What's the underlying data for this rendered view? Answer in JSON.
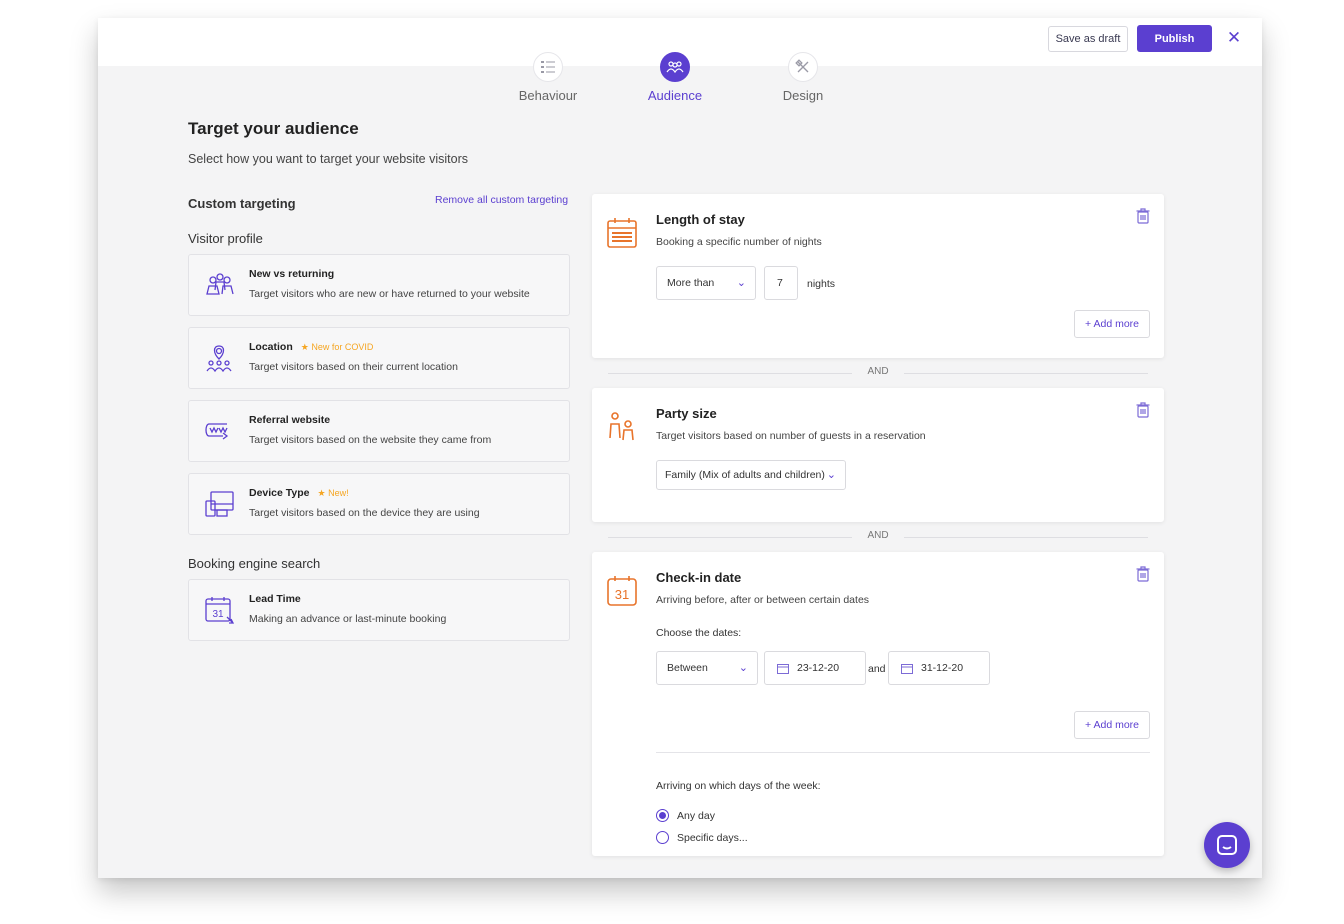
{
  "topbar": {
    "draft_label": "Save as draft",
    "publish_label": "Publish",
    "close_label": "✕"
  },
  "steps": [
    {
      "label": "Behaviour",
      "icon": "list-icon",
      "active": false
    },
    {
      "label": "Audience",
      "icon": "audience-icon",
      "active": true
    },
    {
      "label": "Design",
      "icon": "design-tools-icon",
      "active": false
    }
  ],
  "header": {
    "title": "Target your audience",
    "subtitle": "Select how you want to target your website visitors"
  },
  "custom": {
    "title": "Custom targeting",
    "remove_label": "Remove all custom targeting"
  },
  "visitor_profile": {
    "title": "Visitor profile",
    "options": [
      {
        "title": "New vs returning",
        "badge": "",
        "desc": "Target visitors who are new or have returned to your website",
        "icon": "people-icon"
      },
      {
        "title": "Location",
        "badge": "★ New for COVID",
        "desc": "Target visitors based on their current location",
        "icon": "location-icon"
      },
      {
        "title": "Referral website",
        "badge": "",
        "desc": "Target visitors based on the website they came from",
        "icon": "www-icon"
      },
      {
        "title": "Device Type",
        "badge": "★ New!",
        "desc": "Target visitors based on the device they are using",
        "icon": "devices-icon"
      }
    ]
  },
  "booking_search": {
    "title": "Booking engine search",
    "options": [
      {
        "title": "Lead Time",
        "desc": "Making an advance or last-minute booking",
        "icon": "calendar-31-icon"
      }
    ]
  },
  "stay_card": {
    "title": "Length of stay",
    "desc": "Booking a specific number of nights",
    "condition": "More than",
    "nights_value": "7",
    "nights_label": "nights",
    "add_more": "+ Add more"
  },
  "and_label": "AND",
  "party_card": {
    "title": "Party size",
    "desc": "Target visitors based on number of guests in a reservation",
    "selected": "Family (Mix of adults and children)"
  },
  "checkin_card": {
    "title": "Check-in date",
    "desc": "Arriving before, after or between certain dates",
    "choose_label": "Choose the dates:",
    "condition": "Between",
    "date_from": "23-12-20",
    "and_word": "and",
    "date_to": "31-12-20",
    "add_more": "+ Add more",
    "days_label": "Arriving on which days of the week:",
    "radio_any": "Any day",
    "radio_specific": "Specific days..."
  },
  "colors": {
    "accent": "#5b3fd0",
    "orange": "#e8742b",
    "badge": "#f5a623"
  }
}
